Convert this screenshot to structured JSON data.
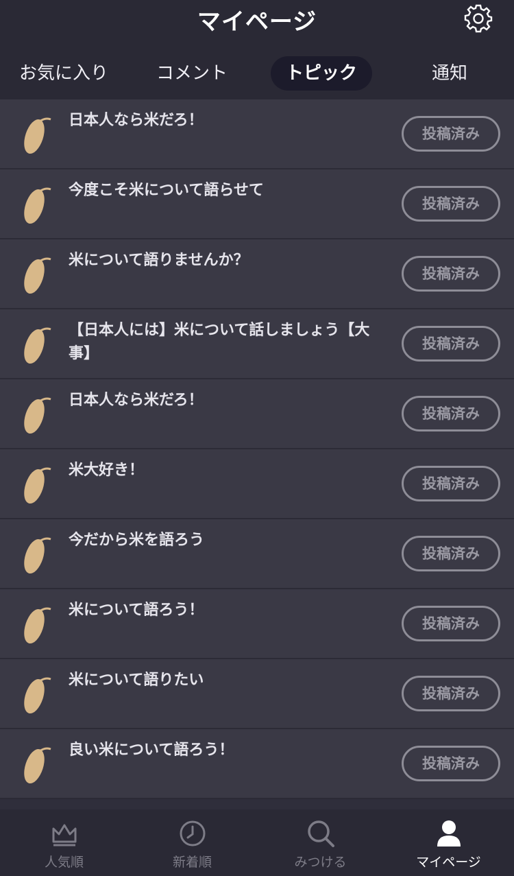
{
  "header": {
    "title": "マイページ",
    "settings_icon": "gear-icon"
  },
  "tabs": [
    {
      "label": "お気に入り",
      "active": false
    },
    {
      "label": "コメント",
      "active": false
    },
    {
      "label": "トピック",
      "active": true
    },
    {
      "label": "通知",
      "active": false
    }
  ],
  "topics": [
    {
      "title": "日本人なら米だろ！",
      "status": "投稿済み"
    },
    {
      "title": "今度こそ米について語らせて",
      "status": "投稿済み"
    },
    {
      "title": "米について語りませんか？",
      "status": "投稿済み"
    },
    {
      "title": "【日本人には】米について話しましょう【大事】",
      "status": "投稿済み"
    },
    {
      "title": "日本人なら米だろ！",
      "status": "投稿済み"
    },
    {
      "title": "米大好き！",
      "status": "投稿済み"
    },
    {
      "title": "今だから米を語ろう",
      "status": "投稿済み"
    },
    {
      "title": "米について語ろう！",
      "status": "投稿済み"
    },
    {
      "title": "米について語りたい",
      "status": "投稿済み"
    },
    {
      "title": "良い米について語ろう！",
      "status": "投稿済み"
    }
  ],
  "topic_icon": "rice-grain-icon",
  "bottom_nav": [
    {
      "label": "人気順",
      "icon": "crown-icon",
      "active": false
    },
    {
      "label": "新着順",
      "icon": "clock-icon",
      "active": false
    },
    {
      "label": "みつける",
      "icon": "search-icon",
      "active": false
    },
    {
      "label": "マイページ",
      "icon": "person-icon",
      "active": true
    }
  ],
  "colors": {
    "background": "#2f2e3b",
    "row": "#3a3945",
    "active_tab": "#1c1b2b",
    "badge_border": "#8e8d97",
    "rice": "#d8b889"
  }
}
